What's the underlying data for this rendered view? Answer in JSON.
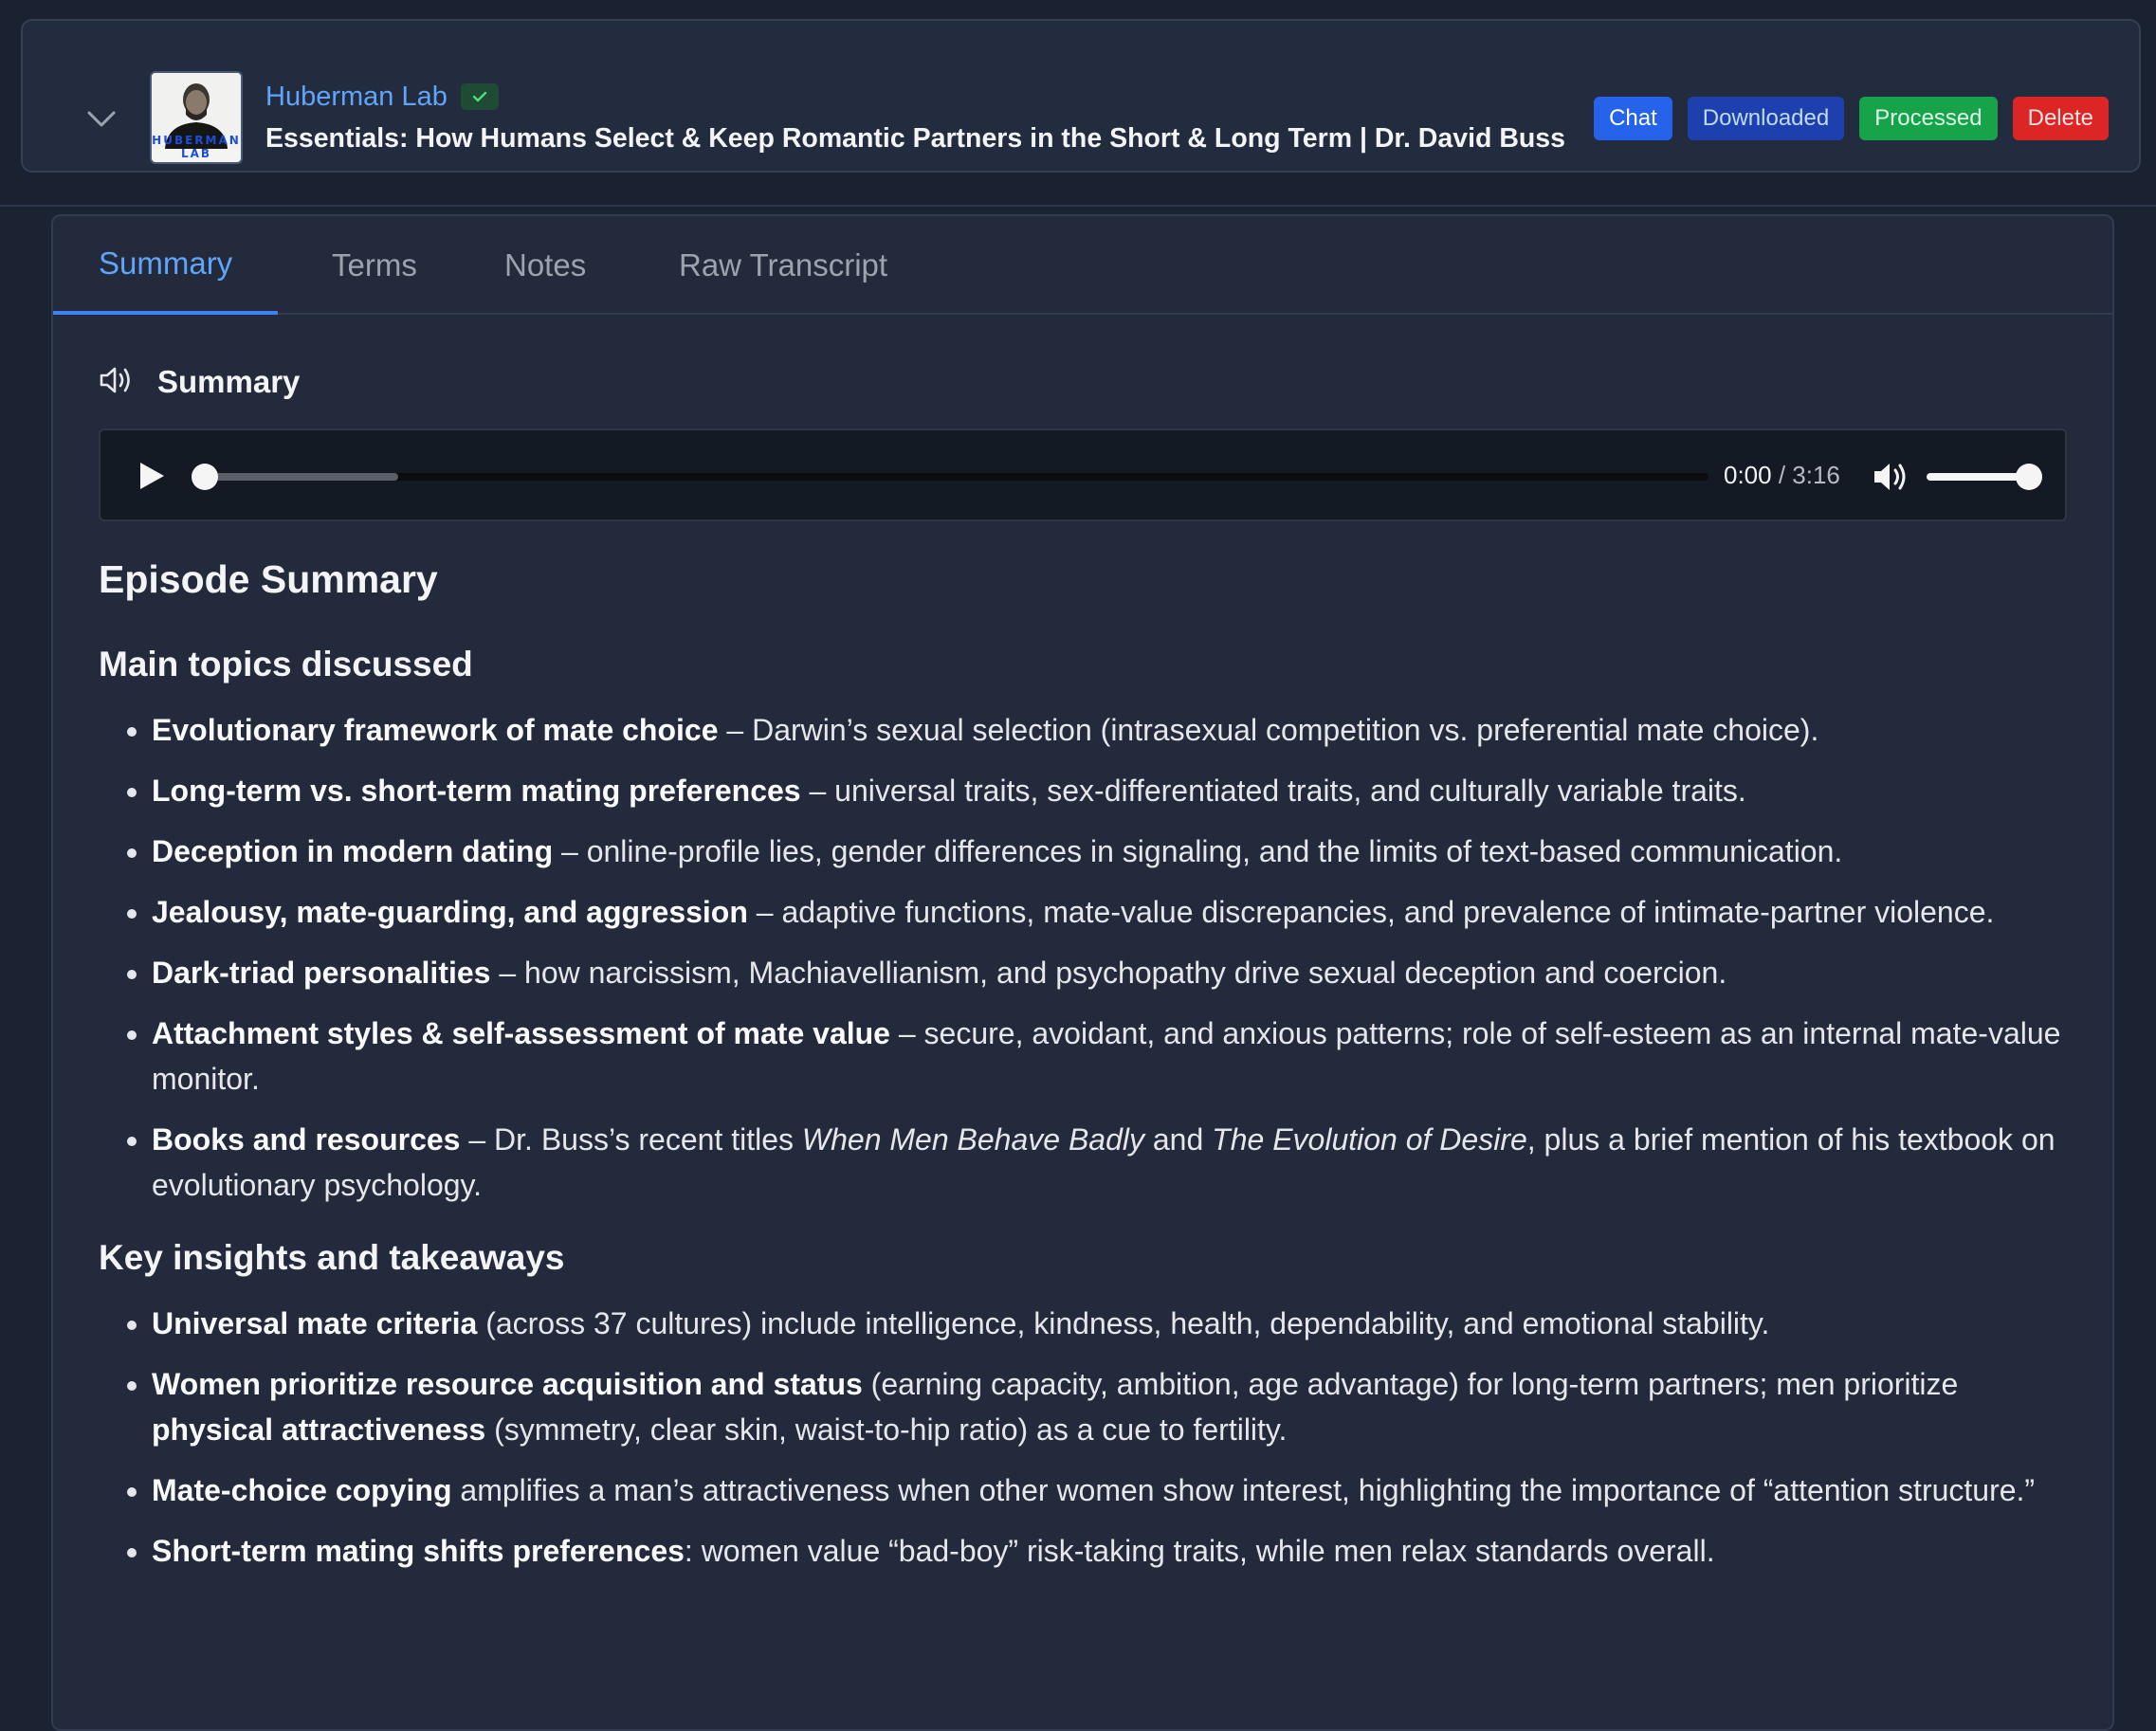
{
  "header": {
    "channel_name": "Huberman Lab",
    "thumbnail_text": "HUBERMAN LAB",
    "episode_title": "Essentials: How Humans Select & Keep Romantic Partners in the Short & Long Term | Dr. David Buss",
    "buttons": {
      "chat": "Chat",
      "downloaded": "Downloaded",
      "processed": "Processed",
      "delete": "Delete"
    }
  },
  "tabs": [
    {
      "label": "Summary",
      "active": true
    },
    {
      "label": "Terms",
      "active": false
    },
    {
      "label": "Notes",
      "active": false
    },
    {
      "label": "Raw Transcript",
      "active": false
    }
  ],
  "section_title": "Summary",
  "audio": {
    "current_time": "0:00",
    "separator": " / ",
    "duration": "3:16",
    "buffered_fraction": 0.13,
    "volume_fraction": 1.0
  },
  "summary": {
    "heading": "Episode Summary",
    "topics_heading": "Main topics discussed",
    "topics": [
      {
        "bold": "Evolutionary framework of mate choice",
        "text": " – Darwin’s sexual selection (intrasexual competition vs. preferential mate choice)."
      },
      {
        "bold": "Long-term vs. short-term mating preferences",
        "text": " – universal traits, sex-differentiated traits, and culturally variable traits."
      },
      {
        "bold": "Deception in modern dating",
        "text": " – online-profile lies, gender differences in signaling, and the limits of text-based communication."
      },
      {
        "bold": "Jealousy, mate-guarding, and aggression",
        "text": " – adaptive functions, mate-value discrepancies, and prevalence of intimate-partner violence."
      },
      {
        "bold": "Dark-triad personalities",
        "text": " – how narcissism, Machiavellianism, and psychopathy drive sexual deception and coercion."
      },
      {
        "bold": "Attachment styles & self-assessment of mate value",
        "text": " – secure, avoidant, and anxious patterns; role of self-esteem as an internal mate-value monitor."
      }
    ],
    "books_item": {
      "bold": "Books and resources",
      "text1": " – Dr. Buss’s recent titles ",
      "italic1": "When Men Behave Badly",
      "text2": " and ",
      "italic2": "The Evolution of Desire",
      "text3": ", plus a brief mention of his textbook on evolutionary psychology."
    },
    "insights_heading": "Key insights and takeaways",
    "insights": {
      "universal": {
        "bold": "Universal mate criteria",
        "text": " (across 37 cultures) include intelligence, kindness, health, dependability, and emotional stability."
      },
      "women": {
        "bold": "Women prioritize resource acquisition and status",
        "text1": " (earning capacity, ambition, age advantage) for long-term partners; men prioritize ",
        "bold2": "physical attractiveness",
        "text2": " (symmetry, clear skin, waist-to-hip ratio) as a cue to fertility."
      },
      "copying": {
        "bold": "Mate-choice copying",
        "text": " amplifies a man’s attractiveness when other women show interest, highlighting the importance of “attention structure.”"
      },
      "short_term": {
        "bold": "Short-term mating shifts preferences",
        "text": ": women value “bad-boy” risk-taking traits, while men relax standards overall."
      }
    }
  }
}
